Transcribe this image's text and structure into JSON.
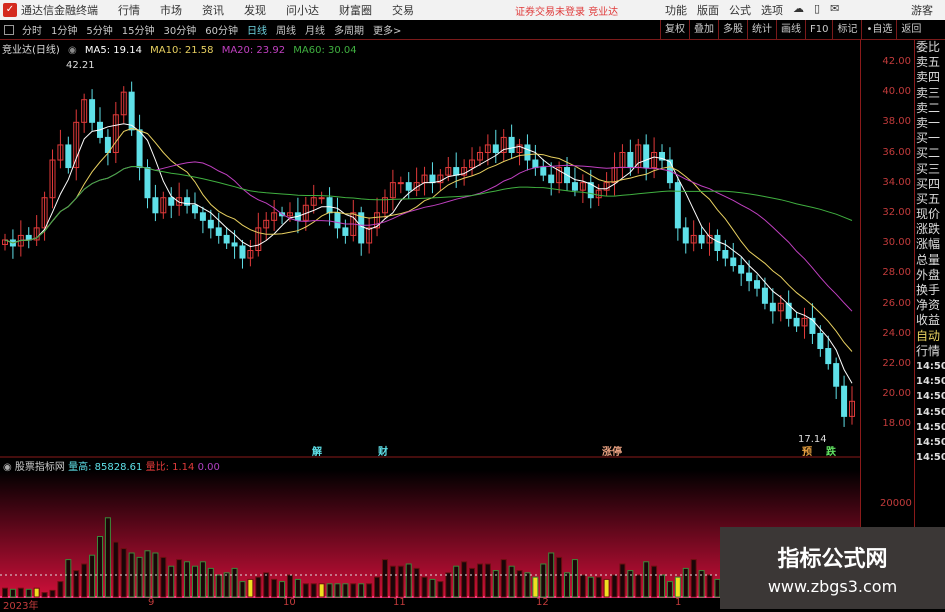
{
  "titlebar": {
    "app": "通达信金融终端",
    "menus": [
      "行情",
      "市场",
      "资讯",
      "发现",
      "问小达",
      "财富圈",
      "交易"
    ],
    "notice": "证券交易未登录",
    "stock_link": "竞业达",
    "right_menus": [
      "功能",
      "版面",
      "公式",
      "选项"
    ],
    "guest": "游客"
  },
  "toolbar": {
    "periods": [
      "分时",
      "1分钟",
      "5分钟",
      "15分钟",
      "30分钟",
      "60分钟",
      "日线",
      "周线",
      "月线",
      "多周期",
      "更多>"
    ],
    "active": "日线",
    "buttons": [
      "复权",
      "叠加",
      "多股",
      "统计",
      "画线",
      "F10",
      "标记",
      "•自选",
      "返回"
    ]
  },
  "info": {
    "name": "竞业达(日线)",
    "ma5": "MA5: 19.14",
    "ma10": "MA10: 21.58",
    "ma20": "MA20: 23.92",
    "ma60": "MA60: 30.04"
  },
  "colors": {
    "up": "#e03a3a",
    "down": "#5fe0e8",
    "ma5": "#ffffff",
    "ma10": "#e8d060",
    "ma20": "#c040c0",
    "ma60": "#40b040"
  },
  "price_axis": [
    "42.00",
    "40.00",
    "38.00",
    "36.00",
    "34.00",
    "32.00",
    "30.00",
    "28.00",
    "26.00",
    "24.00",
    "22.00",
    "20.00",
    "18.00"
  ],
  "right_panel": [
    "委比",
    "卖五",
    "卖四",
    "卖三",
    "卖二",
    "卖一",
    "买一",
    "买二",
    "买三",
    "买四",
    "买五",
    "现价",
    "涨跌",
    "涨幅",
    "总量",
    "外盘",
    "换手",
    "净资",
    "收益",
    "自动",
    "行情",
    "14:50",
    "14:50",
    "14:50",
    "14:50",
    "14:50",
    "14:50",
    "14:50"
  ],
  "annotations": {
    "high": "42.21",
    "low": "17.14",
    "markers": [
      "解",
      "财",
      "涨停",
      "预",
      "跌"
    ]
  },
  "volume": {
    "title": "股票指标网",
    "label1": "量高:",
    "value1": "85828.61",
    "label2": "量比:",
    "value2": "1.14",
    "value3": "0.00",
    "axis": "20000"
  },
  "x_labels": [
    "2023年",
    "9",
    "10",
    "11",
    "12",
    "1"
  ],
  "watermark": {
    "title": "指标公式网",
    "url": "www.zbgs3.com"
  },
  "chart_data": {
    "type": "candlestick",
    "ylim": [
      17,
      43
    ],
    "close": [
      30.2,
      29.8,
      30.5,
      30.2,
      31,
      33,
      35.5,
      36.5,
      35,
      38,
      39.5,
      38,
      37,
      36,
      38.5,
      40,
      37.5,
      35,
      33,
      32,
      33,
      32.5,
      33,
      32.5,
      32,
      31.5,
      31,
      30.5,
      30,
      29.8,
      29,
      29.5,
      31,
      31.5,
      32,
      31.8,
      32,
      31.5,
      32.5,
      33,
      33,
      32,
      31,
      30.5,
      32,
      30,
      31,
      32,
      33,
      34,
      34,
      33.5,
      34,
      34.5,
      34,
      34.5,
      35,
      34.5,
      35,
      35.5,
      36,
      36.5,
      36,
      37,
      36,
      36.5,
      35.5,
      35,
      34.5,
      34,
      35,
      34,
      33.5,
      34,
      33,
      33.5,
      34,
      35,
      36,
      35,
      36.5,
      35,
      36,
      35.5,
      34,
      31,
      30,
      30.5,
      30,
      30.5,
      29.5,
      29,
      28.5,
      28,
      27.5,
      27,
      26,
      25.5,
      26,
      25,
      24.5,
      25,
      24,
      23,
      22,
      20.5,
      18.5,
      19.5
    ],
    "volume": [
      8,
      7,
      8,
      7,
      8,
      4,
      6,
      14,
      34,
      24,
      30,
      38,
      55,
      72,
      50,
      44,
      40,
      36,
      42,
      40,
      36,
      28,
      34,
      32,
      28,
      32,
      26,
      20,
      22,
      26,
      14,
      16,
      18,
      22,
      16,
      14,
      20,
      16,
      12,
      12,
      12,
      12,
      12,
      12,
      12,
      12,
      12,
      18,
      34,
      28,
      28,
      30,
      26,
      18,
      16,
      14,
      22,
      28,
      32,
      26,
      30,
      30,
      24,
      34,
      28,
      24,
      22,
      18,
      30,
      40,
      36,
      22,
      34,
      20,
      18,
      18,
      16,
      20,
      30,
      24,
      20,
      32,
      28,
      20,
      14,
      18,
      26,
      34,
      24,
      20,
      16,
      14,
      12,
      12,
      12,
      12,
      12,
      12,
      12,
      12,
      12,
      12,
      12,
      12,
      12,
      12,
      12,
      12
    ]
  }
}
